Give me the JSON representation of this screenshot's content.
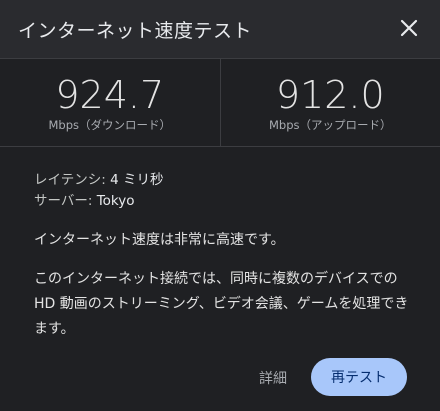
{
  "header": {
    "title": "インターネット速度テスト"
  },
  "metrics": {
    "download": {
      "value": "924.7",
      "label": "Mbps（ダウンロード）"
    },
    "upload": {
      "value": "912.0",
      "label": "Mbps（アップロード）"
    }
  },
  "info": {
    "latency_label": "レイテンシ: ",
    "latency_value": "4 ミリ秒",
    "server_label": "サーバー: ",
    "server_value": "Tokyo"
  },
  "summary": "インターネット速度は非常に高速です。",
  "description": "このインターネット接続では、同時に複数のデバイスでの HD 動画のストリーミング、ビデオ会議、ゲームを処理できます。",
  "buttons": {
    "details": "詳細",
    "retest": "再テスト"
  },
  "colors": {
    "background": "#1f2023",
    "header": "#2a2b2f",
    "accent": "#a8c7fa"
  },
  "icons": {
    "close": "close-icon"
  }
}
